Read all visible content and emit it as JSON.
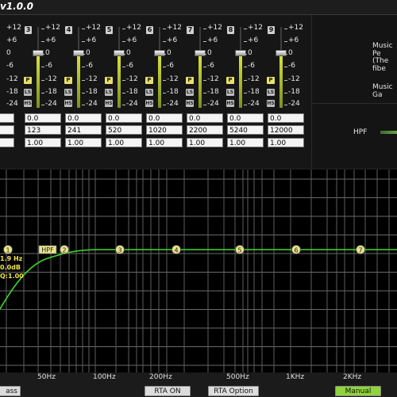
{
  "title": "v1.0.0",
  "channels": [
    {
      "num": "3",
      "freq": "123",
      "gain": "0.0",
      "q": "1.00"
    },
    {
      "num": "4",
      "freq": "241",
      "gain": "0.0",
      "q": "1.00"
    },
    {
      "num": "5",
      "freq": "520",
      "gain": "0.0",
      "q": "1.00"
    },
    {
      "num": "6",
      "freq": "1020",
      "gain": "0.0",
      "q": "1.00"
    },
    {
      "num": "7",
      "freq": "2200",
      "gain": "0.0",
      "q": "1.00"
    },
    {
      "num": "8",
      "freq": "5240",
      "gain": "0.0",
      "q": "1.00"
    },
    {
      "num": "9",
      "freq": "12000",
      "gain": "0.0",
      "q": "1.00"
    }
  ],
  "partial_inputs": {
    "freq": "",
    "gain": "",
    "q": ""
  },
  "scale": [
    "+12",
    "+6",
    "0",
    "-6",
    "-12",
    "-18",
    "-24"
  ],
  "buttons": {
    "p": "P",
    "ls": "LS",
    "hs": "HS"
  },
  "right_panel": {
    "music_line1": "Music Pe",
    "music_line2": "(The fibe",
    "music_gain": "Music Ga",
    "hpf_label": "HPF"
  },
  "graph": {
    "markers": [
      "1",
      "2",
      "3",
      "4",
      "5",
      "6",
      "7"
    ],
    "hpf_tag": "HPF",
    "info": [
      "1.9 Hz",
      "0.0dB",
      "Q:1.00"
    ],
    "freq_labels": [
      "50Hz",
      "100Hz",
      "200Hz",
      "500Hz",
      "1KHz",
      "2KHz"
    ]
  },
  "bottom": {
    "left_btn": "ass",
    "rta_on": "RTA ON",
    "rta_option": "RTA Option",
    "manual": "Manual"
  },
  "colors": {
    "curve": "#3ddc2a",
    "marker": "#e8e38a",
    "manual_active": "#8fd43a",
    "slider_fill": "#c8d43a"
  }
}
